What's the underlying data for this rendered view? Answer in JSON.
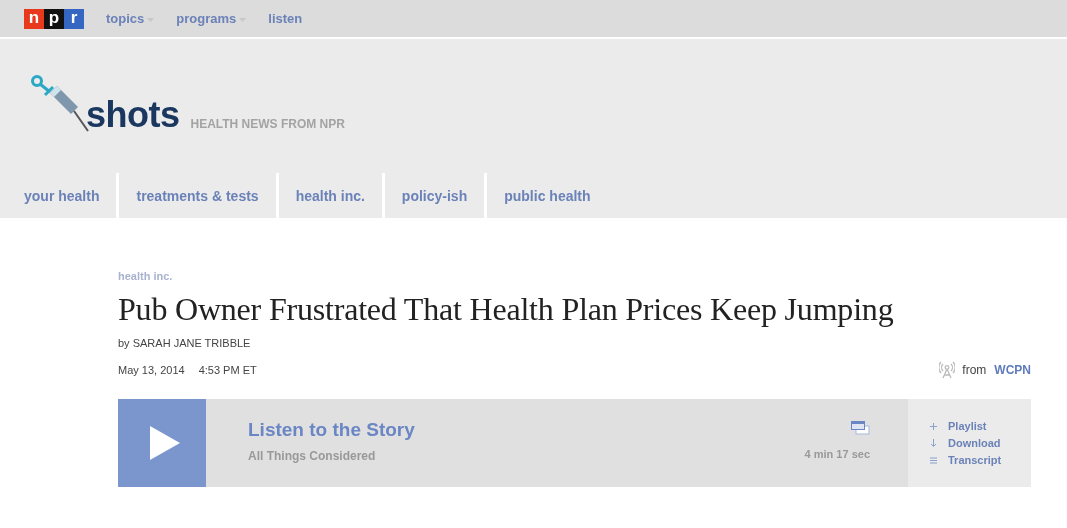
{
  "top_nav": {
    "logo_letters": [
      "n",
      "p",
      "r"
    ],
    "items": [
      {
        "label": "topics",
        "dropdown": true
      },
      {
        "label": "programs",
        "dropdown": true
      },
      {
        "label": "listen",
        "dropdown": false
      }
    ]
  },
  "blog_header": {
    "name": "shots",
    "tagline": "HEALTH NEWS FROM NPR"
  },
  "section_nav": [
    "your health",
    "treatments & tests",
    "health inc.",
    "policy-ish",
    "public health"
  ],
  "article": {
    "category": "health inc.",
    "title": "Pub Owner Frustrated That Health Plan Prices Keep Jumping",
    "byline": "by SARAH JANE TRIBBLE",
    "date": "May 13, 2014",
    "time": "4:53 PM ET",
    "source_label": "from",
    "source": "WCPN"
  },
  "audio": {
    "title": "Listen to the Story",
    "program": "All Things Considered",
    "duration": "4 min 17 sec",
    "actions": [
      {
        "kind": "add",
        "label": "Playlist"
      },
      {
        "kind": "download",
        "label": "Download"
      },
      {
        "kind": "transcript",
        "label": "Transcript"
      }
    ]
  }
}
